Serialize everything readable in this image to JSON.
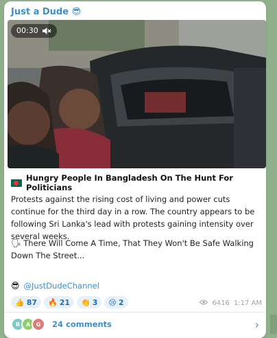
{
  "channel_name": "Just a Dude 😎",
  "video": {
    "duration": "00:30",
    "mute_icon": "muted-speaker-icon"
  },
  "headline": "Hungry People In Bangladesh On The Hunt For Politicians",
  "paragraph1": "Protests against the rising cost of living and power cuts continue for the third day in a row. The country appears to be following Sri Lanka's lead with protests gaining intensity over several weeks.",
  "paragraph2": "🗣 There Will Come A Time, That They Won't Be Safe Walking Down The Street...",
  "signature": {
    "emoji": "😎",
    "handle": "@JustDudeChannel"
  },
  "reactions": [
    {
      "emoji": "👍",
      "count": "87"
    },
    {
      "emoji": "🔥",
      "count": "21"
    },
    {
      "emoji": "👏",
      "count": "3"
    },
    {
      "emoji": "😢",
      "count": "2"
    }
  ],
  "views": "6416",
  "time": "1:17 AM",
  "comments": {
    "label": "24 comments",
    "avatars": [
      {
        "letter": "R",
        "color": "#7ec8c6"
      },
      {
        "letter": "A",
        "color": "#8fcf6a"
      },
      {
        "letter": "G",
        "color": "#e07a7a"
      }
    ]
  },
  "colors": {
    "accent": "#3a8fd0",
    "background": "#8fb08a"
  }
}
